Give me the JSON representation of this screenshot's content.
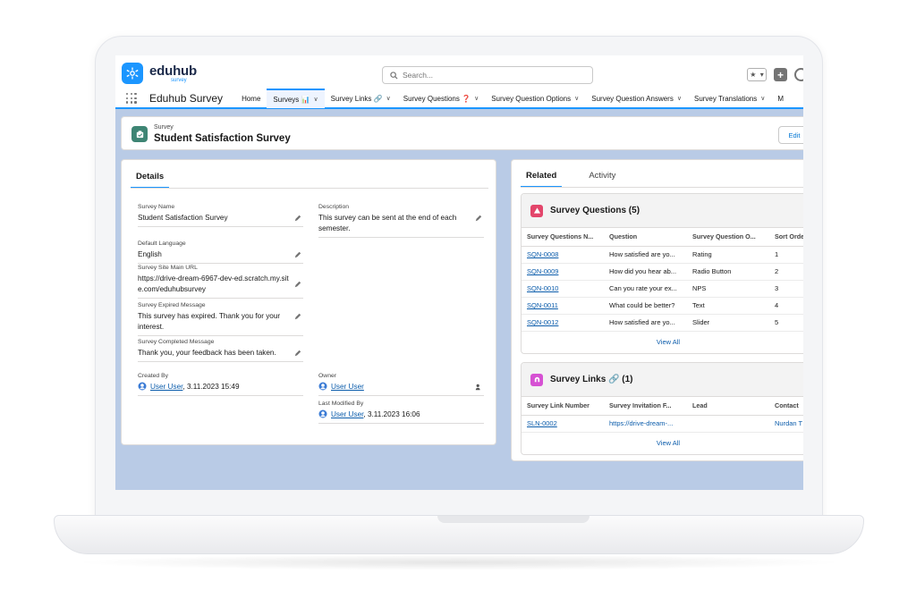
{
  "app": {
    "logo_text": "eduhub",
    "logo_sub": "survey",
    "search_placeholder": "Search...",
    "app_name": "Eduhub Survey"
  },
  "nav": {
    "tabs": [
      {
        "label": "Home",
        "dropdown": false
      },
      {
        "label": "Surveys 📊",
        "dropdown": true,
        "active": true
      },
      {
        "label": "Survey Links 🔗",
        "dropdown": true
      },
      {
        "label": "Survey Questions ❓",
        "dropdown": true
      },
      {
        "label": "Survey Question Options",
        "dropdown": true
      },
      {
        "label": "Survey Question Answers",
        "dropdown": true
      },
      {
        "label": "Survey Translations",
        "dropdown": true
      },
      {
        "label": "M",
        "dropdown": false
      }
    ]
  },
  "record": {
    "type": "Survey",
    "name": "Student Satisfaction Survey",
    "edit_label": "Edit"
  },
  "details": {
    "tab_label": "Details",
    "survey_name": {
      "label": "Survey Name",
      "value": "Student Satisfaction Survey"
    },
    "description": {
      "label": "Description",
      "value": "This survey can be sent at the end of each semester."
    },
    "default_language": {
      "label": "Default Language",
      "value": "English"
    },
    "site_url": {
      "label": "Survey Site Main URL",
      "value": "https://drive-dream-6967-dev-ed.scratch.my.site.com/eduhubsurvey"
    },
    "expired_message": {
      "label": "Survey Expired Message",
      "value": "This survey has expired. Thank you for your interest."
    },
    "completed_message": {
      "label": "Survey Completed Message",
      "value": "Thank you, your feedback has been taken."
    },
    "created_by": {
      "label": "Created By",
      "user": "User User",
      "date": ", 3.11.2023 15:49"
    },
    "owner": {
      "label": "Owner",
      "user": "User User"
    },
    "last_modified": {
      "label": "Last Modified By",
      "user": "User User",
      "date": ", 3.11.2023 16:06"
    }
  },
  "related": {
    "tabs": [
      "Related",
      "Activity"
    ],
    "questions": {
      "title": "Survey Questions (5)",
      "columns": [
        "Survey Questions N...",
        "Question",
        "Survey Question O...",
        "Sort Orde"
      ],
      "rows": [
        [
          "SQN-0008",
          "How satisfied are yo...",
          "Rating",
          "1"
        ],
        [
          "SQN-0009",
          "How did you hear ab...",
          "Radio Button",
          "2"
        ],
        [
          "SQN-0010",
          "Can you rate your ex...",
          "NPS",
          "3"
        ],
        [
          "SQN-0011",
          "What could be better?",
          "Text",
          "4"
        ],
        [
          "SQN-0012",
          "How satisfied are yo...",
          "Slider",
          "5"
        ]
      ],
      "view_all": "View All"
    },
    "links": {
      "title": "Survey Links 🔗 (1)",
      "columns": [
        "Survey Link Number",
        "Survey Invitation F...",
        "Lead",
        "Contact"
      ],
      "rows": [
        [
          "SLN-0002",
          "https://drive-dream-...",
          "",
          "Nurdan T"
        ]
      ],
      "view_all": "View All"
    }
  },
  "colors": {
    "brand": "#1b96ff",
    "link": "#0b5cab",
    "survey_icon": "#3e8574",
    "questions_icon": "#e3466b",
    "links_icon": "#d651d3"
  }
}
